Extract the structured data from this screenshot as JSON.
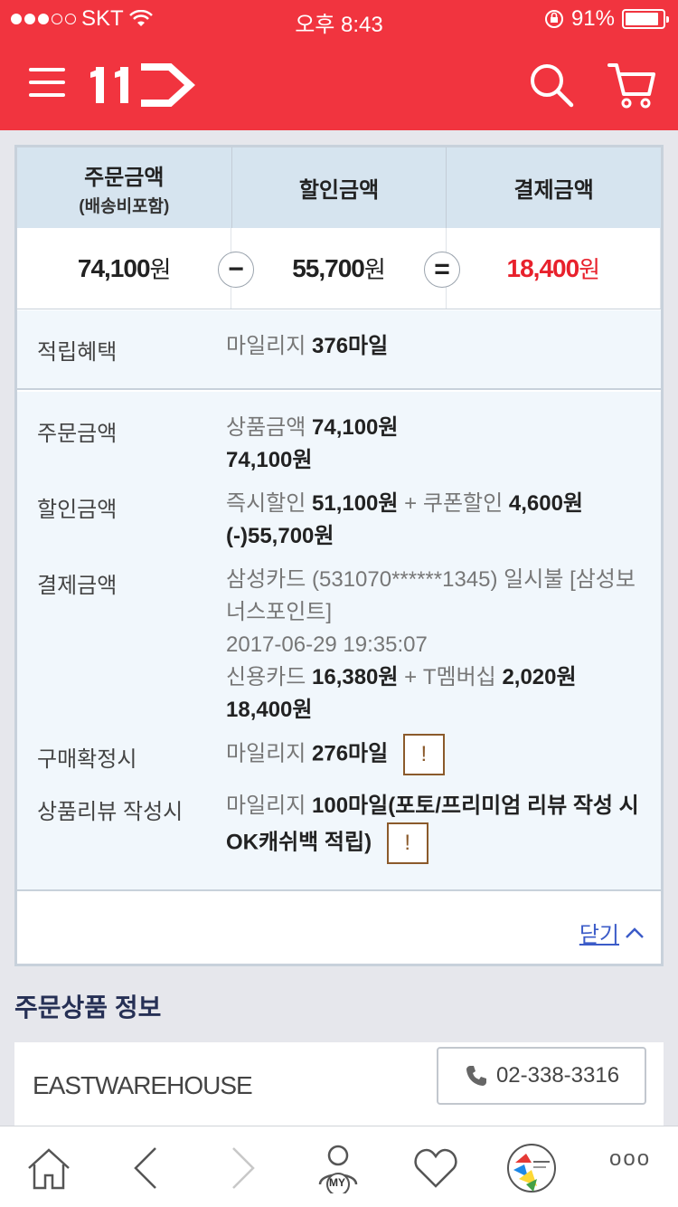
{
  "status_bar": {
    "carrier": "SKT",
    "time": "오후 8:43",
    "battery_percent": "91%",
    "battery_level": 0.91
  },
  "header": {
    "logo": "11",
    "icons": [
      "menu-icon",
      "search-icon",
      "cart-icon"
    ]
  },
  "summary": {
    "headers": {
      "order_amount": "주문금액",
      "order_amount_sub": "(배송비포함)",
      "discount_amount": "할인금액",
      "payment_amount": "결제금액"
    },
    "values": {
      "order_amount": "74,100",
      "discount_amount": "55,700",
      "payment_amount": "18,400",
      "unit": "원"
    },
    "operators": {
      "minus": "−",
      "equals": "="
    },
    "accent_color": "#e8212c"
  },
  "reward": {
    "label": "적립혜택",
    "prefix": "마일리지",
    "value": "376마일"
  },
  "details": {
    "order": {
      "label": "주문금액",
      "line1_prefix": "상품금액",
      "line1_value": "74,100원",
      "total": "74,100원"
    },
    "discount": {
      "label": "할인금액",
      "instant_prefix": "즉시할인",
      "instant_value": "51,100원",
      "plus": "+",
      "coupon_prefix": "쿠폰할인",
      "coupon_value": "4,600원",
      "total": "(-)55,700원"
    },
    "payment": {
      "label": "결제금액",
      "card_line1": "삼성카드 (531070******1345) 일시불 [삼성보",
      "card_line2": "너스포인트]",
      "datetime": "2017-06-29 19:35:07",
      "credit_prefix": "신용카드",
      "credit_value": "16,380원",
      "plus": "+",
      "tmember_prefix": "T멤버십",
      "tmember_value": "2,020원",
      "total": "18,400원"
    },
    "confirm": {
      "label": "구매확정시",
      "prefix": "마일리지",
      "value": "276마일",
      "warn": "!"
    },
    "review": {
      "label": "상품리뷰 작성시",
      "prefix": "마일리지",
      "value_line1": "100마일(포토/프리미엄 리뷰 작성 시",
      "value_line2": "OK캐쉬백 적립)",
      "warn": "!"
    }
  },
  "close_label": "닫기",
  "order_items": {
    "title": "주문상품 정보",
    "seller": "EASTWAREHOUSE",
    "phone": "02-338-3316"
  },
  "tabbar": {
    "items": [
      "home-icon",
      "back-icon",
      "forward-icon",
      "my-icon",
      "heart-icon",
      "recent-item-thumb",
      "more-icon"
    ],
    "my_label": "MY",
    "more_label": "ooo"
  },
  "colors": {
    "brand": "#f1343f",
    "header_bg": "#d6e4ef",
    "link": "#3b5bc8",
    "section_title": "#263055"
  }
}
